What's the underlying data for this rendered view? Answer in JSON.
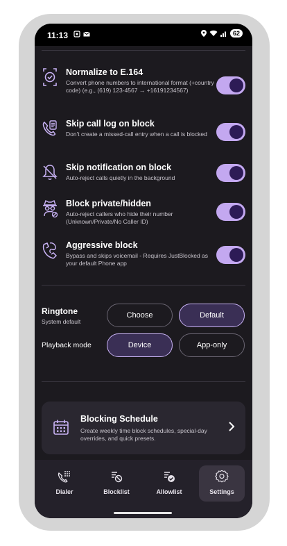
{
  "status_bar": {
    "time": "11:13",
    "battery": "62"
  },
  "toggles": [
    {
      "title": "Normalize to E.164",
      "desc": "Convert phone numbers to international format (+country code) (e.g., (619) 123-4567 → +16191234567)",
      "on": true,
      "icon": "check-badge-icon"
    },
    {
      "title": "Skip call log on block",
      "desc": "Don't create a missed-call entry when a call is blocked",
      "on": true,
      "icon": "phone-log-icon"
    },
    {
      "title": "Skip notification on block",
      "desc": "Auto-reject calls quietly in the background",
      "on": true,
      "icon": "bell-off-icon"
    },
    {
      "title": "Block private/hidden",
      "desc": "Auto-reject callers who hide their number (Unknown/Private/No Caller ID)",
      "on": true,
      "icon": "spy-icon"
    },
    {
      "title": "Aggressive block",
      "desc": "Bypass and skips voicemail - Requires JustBlocked as your default Phone app",
      "on": true,
      "icon": "disconnect-icon"
    }
  ],
  "ringtone": {
    "title": "Ringtone",
    "subtitle": "System default",
    "choose_label": "Choose",
    "default_label": "Default",
    "playback_label": "Playback mode",
    "device_label": "Device",
    "apponly_label": "App-only"
  },
  "schedule": {
    "title": "Blocking Schedule",
    "desc": "Create weekly time block schedules, special-day overrides, and quick presets."
  },
  "nav": [
    {
      "label": "Dialer",
      "icon": "dialpad-icon",
      "active": false
    },
    {
      "label": "Blocklist",
      "icon": "blocklist-icon",
      "active": false
    },
    {
      "label": "Allowlist",
      "icon": "allowlist-icon",
      "active": false
    },
    {
      "label": "Settings",
      "icon": "gear-icon",
      "active": true
    }
  ],
  "colors": {
    "accent": "#c3a8f0",
    "knob": "#2d1b56",
    "icon": "#c9b3f5",
    "background": "#1c1a1f"
  }
}
